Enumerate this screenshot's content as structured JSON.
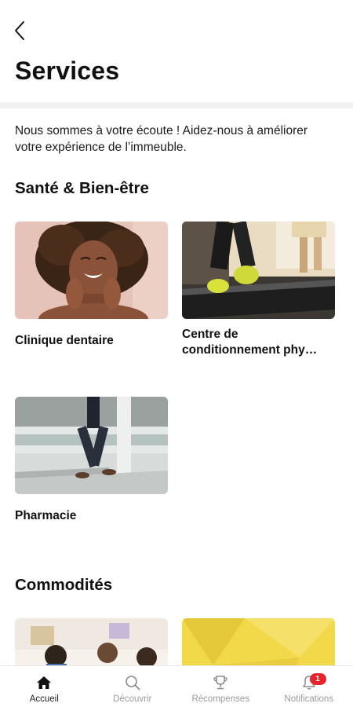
{
  "header": {
    "title": "Services"
  },
  "intro": "Nous sommes à votre écoute ! Aidez-nous à améliorer votre expérience de l’immeuble.",
  "sections": [
    {
      "title": "Santé & Bien-être",
      "items": [
        {
          "label": "Clinique dentaire"
        },
        {
          "label": "Centre de conditionnement phy…"
        },
        {
          "label": "Pharmacie"
        }
      ]
    },
    {
      "title": "Commodités"
    }
  ],
  "bottom_nav": [
    {
      "label": "Accueil",
      "icon": "home-icon",
      "active": true
    },
    {
      "label": "Découvrir",
      "icon": "search-icon"
    },
    {
      "label": "Récompenses",
      "icon": "trophy-icon"
    },
    {
      "label": "Notifications",
      "icon": "bell-icon",
      "badge": "1"
    }
  ],
  "colors": {
    "badge": "#e8242b",
    "active_nav": "#222222",
    "inactive_nav": "#9a9a9a",
    "divider": "#f1f1f1"
  }
}
